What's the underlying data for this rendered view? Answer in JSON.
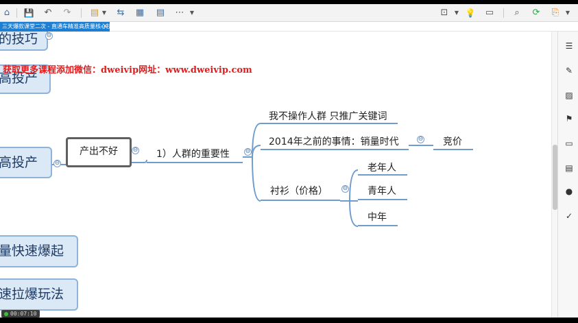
{
  "toolbar": {
    "home": "⌂",
    "save": "💾",
    "undo": "↶",
    "redo": "↷",
    "format_painter": "▤",
    "flow": "⇆",
    "insert_picture": "▦",
    "insert_topic": "▤",
    "more": "⋯",
    "present": "⊡",
    "idea": "💡",
    "outline": "▭",
    "search": "⌕",
    "share": "⟳",
    "export": "⎘"
  },
  "tab": {
    "title": "三天爆款课堂二次 - 直通车精准高质量核心技巧",
    "close": "✕"
  },
  "watermark": "获取更多课程添加微信：dweivip网址：www.dweivip.com",
  "nodes": {
    "top_partial": "的技巧",
    "gao_touchan_top": "高投产",
    "gao_touchan_mid": "高投产",
    "liang_kuaisu": "量快速爆起",
    "su_labao": "速拉爆玩法"
  },
  "mindmap": {
    "selected": "产出不好",
    "level1": "1）人群的重要性",
    "branch1": "我不操作人群  只推广关键词",
    "branch2": "2014年之前的事情：销量时代",
    "branch2_child": "竞价",
    "branch3": "衬衫（价格）",
    "branch3_children": [
      "老年人",
      "青年人",
      "中年"
    ]
  },
  "collapse_symbol": "⊖",
  "right_panel": {
    "icons": [
      "☰",
      "✎",
      "▨",
      "⚑",
      "▭",
      "▤",
      "●",
      "✓"
    ]
  },
  "timer": "00:07:10"
}
